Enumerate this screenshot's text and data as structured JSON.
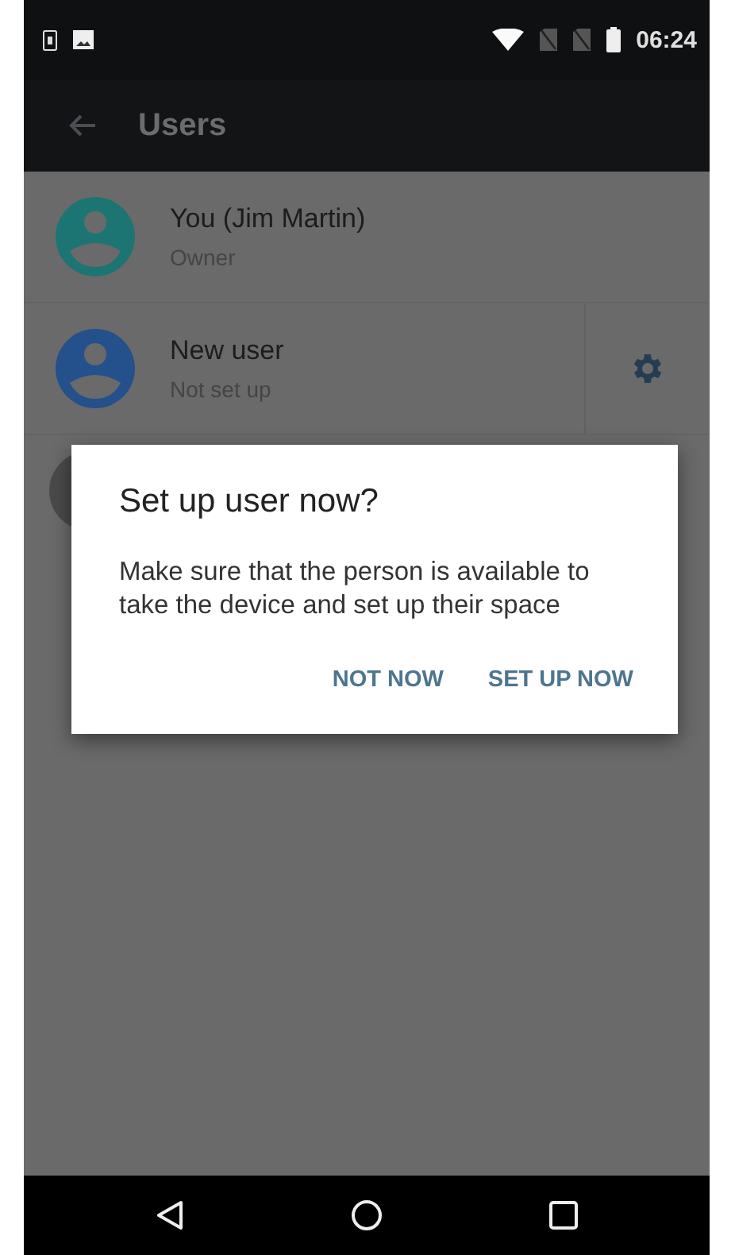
{
  "status_bar": {
    "time": "06:24"
  },
  "app_bar": {
    "title": "Users"
  },
  "users": [
    {
      "name": "You (Jim Martin)",
      "subtitle": "Owner",
      "color": "#1d7573",
      "settings": false
    },
    {
      "name": "New user",
      "subtitle": "Not set up",
      "color": "#24508c",
      "settings": true
    }
  ],
  "dialog": {
    "title": "Set up user now?",
    "message": "Make sure that the person is available to take the device and set up their space",
    "buttons": [
      "NOT NOW",
      "SET UP NOW"
    ]
  }
}
